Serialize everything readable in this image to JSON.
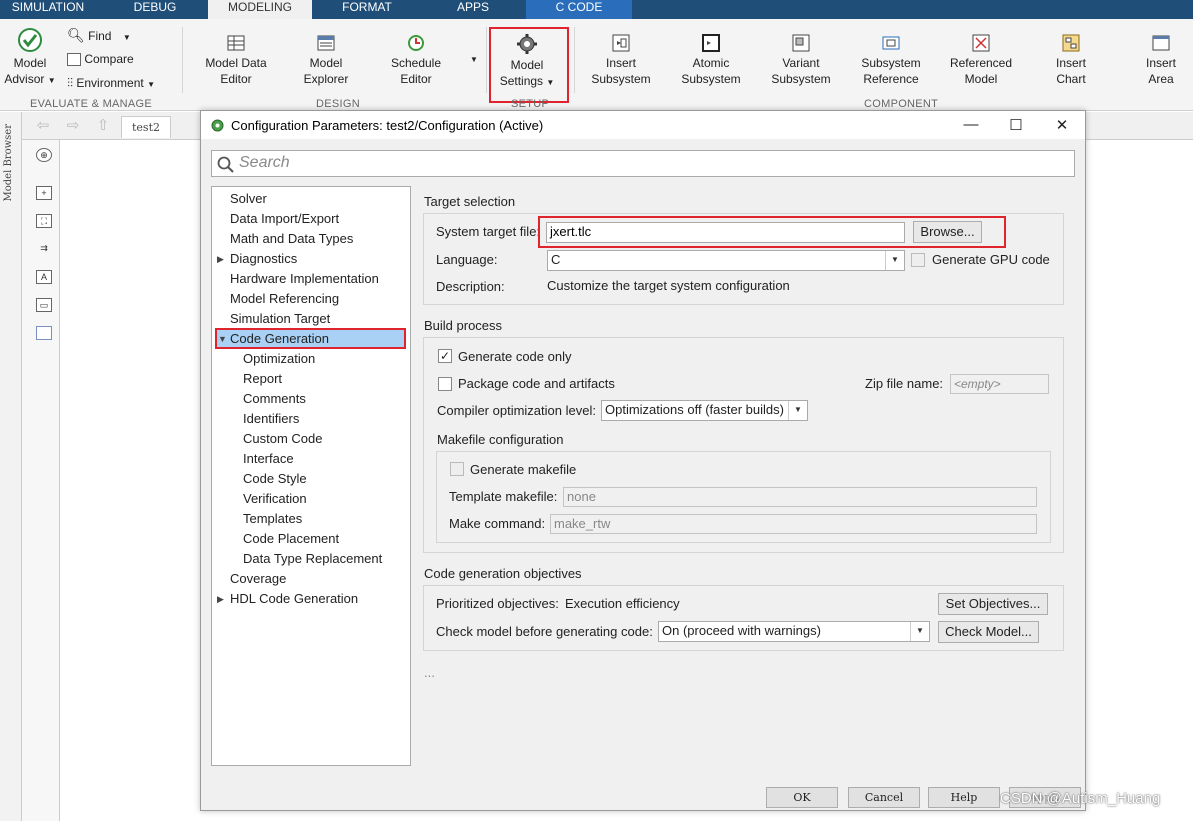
{
  "tabs": [
    "SIMULATION",
    "DEBUG",
    "MODELING",
    "FORMAT",
    "APPS",
    "C CODE"
  ],
  "ribbon": {
    "evaluate": {
      "model_advisor_1": "Model",
      "model_advisor_2": "Advisor",
      "find": "Find",
      "compare": "Compare",
      "environment": "Environment",
      "group": "EVALUATE & MANAGE"
    },
    "design": {
      "mde_1": "Model Data",
      "mde_2": "Editor",
      "me_1": "Model",
      "me_2": "Explorer",
      "se_1": "Schedule",
      "se_2": "Editor",
      "group": "DESIGN"
    },
    "setup": {
      "ms_1": "Model",
      "ms_2": "Settings",
      "group": "SETUP"
    },
    "component": {
      "is_1": "Insert",
      "is_2": "Subsystem",
      "as_1": "Atomic",
      "as_2": "Subsystem",
      "vs_1": "Variant",
      "vs_2": "Subsystem",
      "sr_1": "Subsystem",
      "sr_2": "Reference",
      "rm_1": "Referenced",
      "rm_2": "Model",
      "ic_1": "Insert",
      "ic_2": "Chart",
      "ia_1": "Insert",
      "ia_2": "Area",
      "group": "COMPONENT"
    }
  },
  "model_browser_label": "Model Browser",
  "breadcrumb_tab": "test2",
  "dialog": {
    "title": "Configuration Parameters: test2/Configuration (Active)",
    "search_placeholder": "Search",
    "tree": [
      "Solver",
      "Data Import/Export",
      "Math and Data Types",
      "Diagnostics",
      "Hardware Implementation",
      "Model Referencing",
      "Simulation Target",
      "Code Generation",
      "Optimization",
      "Report",
      "Comments",
      "Identifiers",
      "Custom Code",
      "Interface",
      "Code Style",
      "Verification",
      "Templates",
      "Code Placement",
      "Data Type Replacement",
      "Coverage",
      "HDL Code Generation"
    ],
    "target": {
      "section": "Target selection",
      "stf_label": "System target file:",
      "stf_value": "jxert.tlc",
      "browse": "Browse...",
      "lang_label": "Language:",
      "lang_value": "C",
      "gpu": "Generate GPU code",
      "desc_label": "Description:",
      "desc_value": "Customize the target system configuration"
    },
    "build": {
      "section": "Build process",
      "gen_only": "Generate code only",
      "package": "Package code and artifacts",
      "zip_label": "Zip file name:",
      "zip_placeholder": "<empty>",
      "opt_label": "Compiler optimization level:",
      "opt_value": "Optimizations off (faster builds)",
      "makefile_section": "Makefile configuration",
      "gen_makefile": "Generate makefile",
      "template_label": "Template makefile:",
      "template_value": "none",
      "make_label": "Make command:",
      "make_value": "make_rtw"
    },
    "objectives": {
      "section": "Code generation objectives",
      "prio_label": "Prioritized objectives:",
      "prio_value": "Execution efficiency",
      "set_obj": "Set Objectives...",
      "check_label": "Check model before generating code:",
      "check_value": "On (proceed with warnings)",
      "check_model": "Check Model..."
    },
    "ellipsis": "...",
    "buttons": {
      "ok": "OK",
      "cancel": "Cancel",
      "help": "Help",
      "apply": "Apply"
    }
  },
  "watermark": "CSDN @Autism_Huang",
  "colors": {
    "tabbar": "#1f4e79",
    "ccode_tab": "#2a6ebb",
    "highlight": "#e0242e",
    "selection": "#a9d1f5"
  }
}
